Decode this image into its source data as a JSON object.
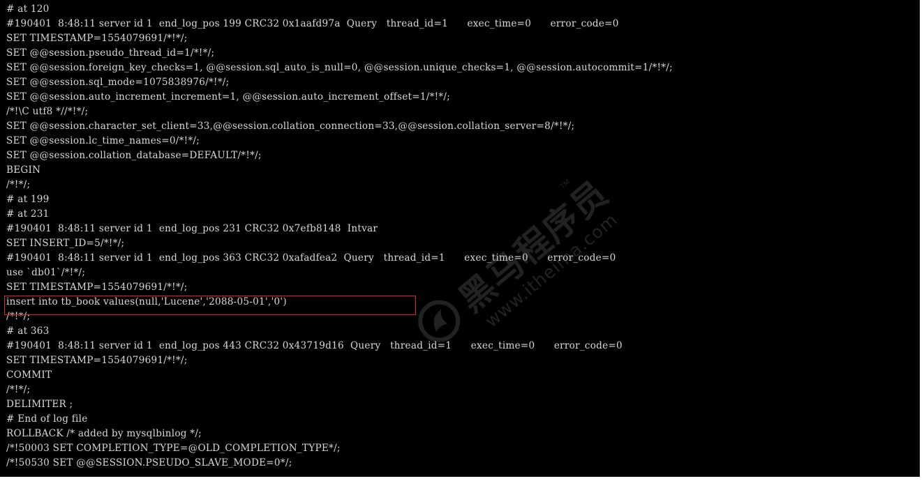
{
  "terminal": {
    "lines": [
      "# at 120",
      "#190401  8:48:11 server id 1  end_log_pos 199 CRC32 0x1aafd97a  Query   thread_id=1      exec_time=0      error_code=0",
      "SET TIMESTAMP=1554079691/*!*/;",
      "SET @@session.pseudo_thread_id=1/*!*/;",
      "SET @@session.foreign_key_checks=1, @@session.sql_auto_is_null=0, @@session.unique_checks=1, @@session.autocommit=1/*!*/;",
      "SET @@session.sql_mode=1075838976/*!*/;",
      "SET @@session.auto_increment_increment=1, @@session.auto_increment_offset=1/*!*/;",
      "/*!\\C utf8 *//*!*/;",
      "SET @@session.character_set_client=33,@@session.collation_connection=33,@@session.collation_server=8/*!*/;",
      "SET @@session.lc_time_names=0/*!*/;",
      "SET @@session.collation_database=DEFAULT/*!*/;",
      "BEGIN",
      "/*!*/;",
      "# at 199",
      "# at 231",
      "#190401  8:48:11 server id 1  end_log_pos 231 CRC32 0x7efb8148  Intvar",
      "SET INSERT_ID=5/*!*/;",
      "#190401  8:48:11 server id 1  end_log_pos 363 CRC32 0xafadfea2  Query   thread_id=1      exec_time=0      error_code=0",
      "use `db01`/*!*/;",
      "SET TIMESTAMP=1554079691/*!*/;",
      "insert into tb_book values(null,'Lucene','2088-05-01','0')",
      "/*!*/;",
      "# at 363",
      "#190401  8:48:11 server id 1  end_log_pos 443 CRC32 0x43719d16  Query   thread_id=1      exec_time=0      error_code=0",
      "SET TIMESTAMP=1554079691/*!*/;",
      "COMMIT",
      "/*!*/;",
      "DELIMITER ;",
      "# End of log file",
      "ROLLBACK /* added by mysqlbinlog */;",
      "/*!50003 SET COMPLETION_TYPE=@OLD_COMPLETION_TYPE*/;",
      "/*!50530 SET @@SESSION.PSEUDO_SLAVE_MODE=0*/;"
    ],
    "highlighted_line_index": 20
  },
  "watermark": {
    "brand_cn": "黑马程序员",
    "tm": "TM",
    "url": "www.itheima.com"
  },
  "colors": {
    "background": "#000000",
    "text": "#d9d9d9",
    "highlight_border": "#d92525"
  }
}
